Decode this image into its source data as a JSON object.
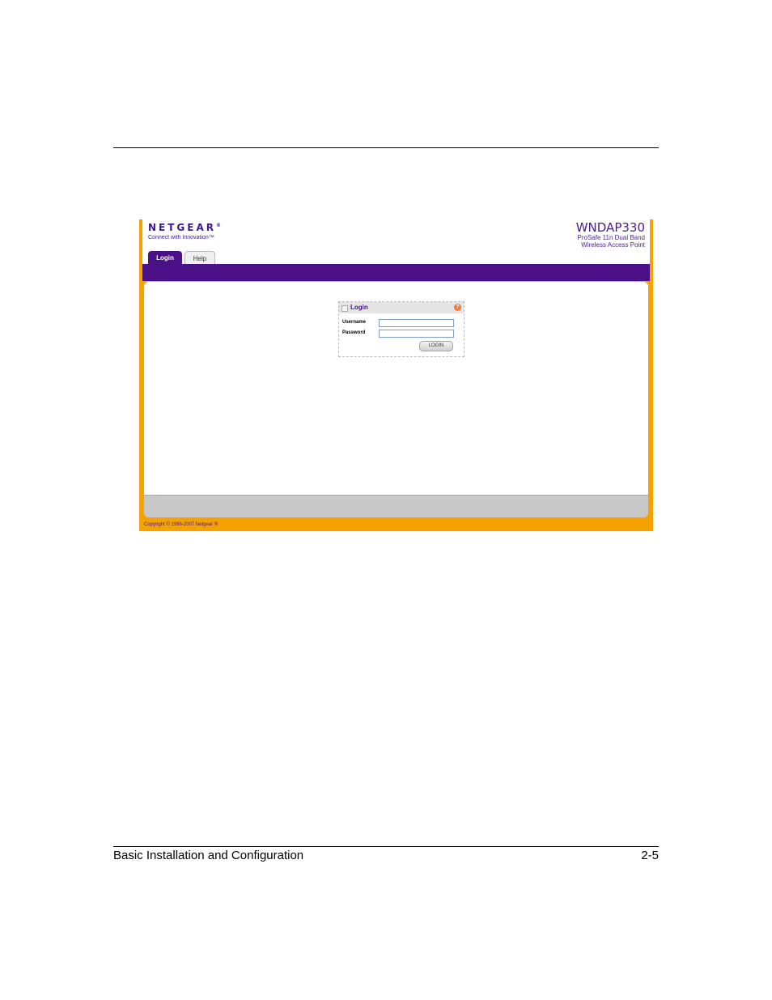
{
  "page": {
    "footer_left": "Basic Installation and Configuration",
    "footer_right": "2-5"
  },
  "screenshot": {
    "logo": {
      "text": "NETGEAR",
      "reg": "®",
      "tagline": "Connect with Innovation™"
    },
    "product": {
      "model": "WNDAP330",
      "line1": "ProSafe 11n Dual Band",
      "line2": "Wireless Access Point"
    },
    "tabs": [
      {
        "label": "Login"
      },
      {
        "label": "Help"
      }
    ],
    "login": {
      "title": "Login",
      "username_label": "Username",
      "password_label": "Password",
      "username_value": "",
      "password_value": "",
      "button_label": "LOGIN"
    },
    "copyright": "Copyright © 1996-2007 Netgear ®"
  },
  "colors": {
    "brand_purple": "#4b1086",
    "brand_orange": "#f5a200"
  }
}
